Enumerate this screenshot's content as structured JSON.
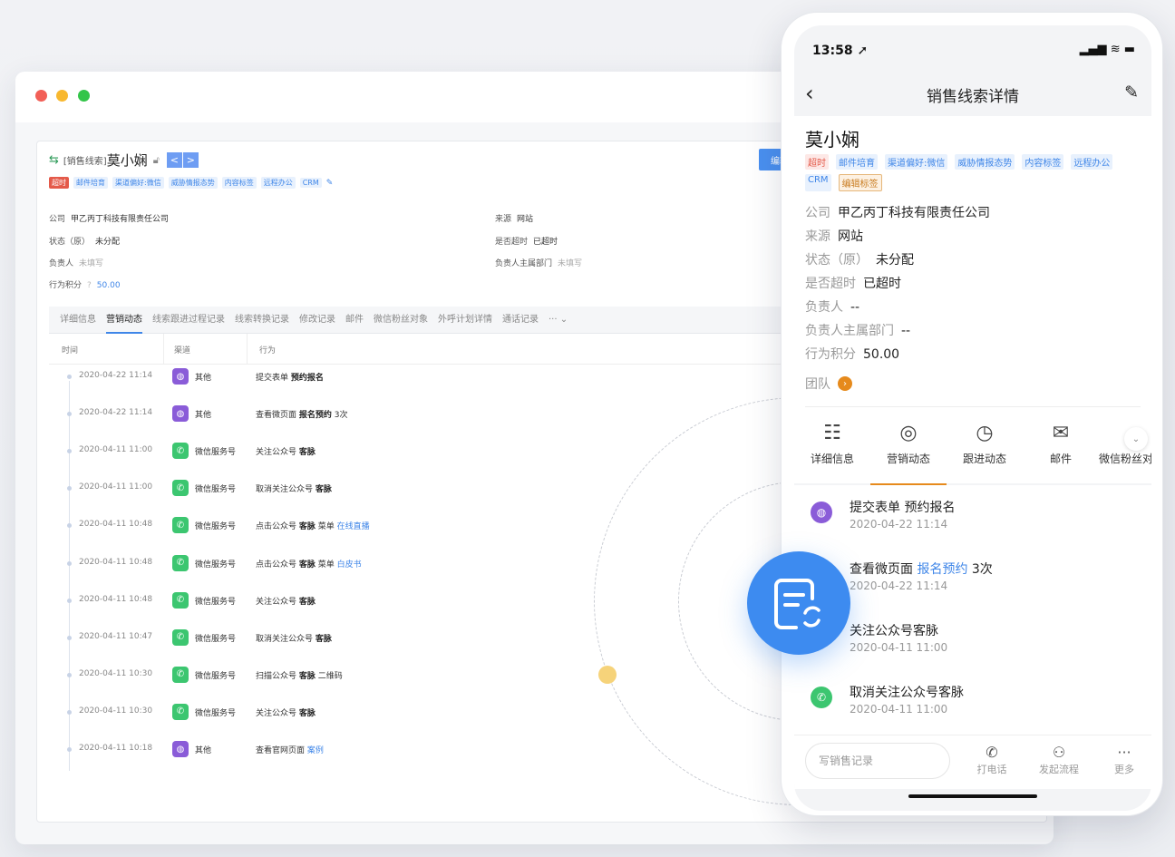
{
  "desktop": {
    "header": {
      "crumb": "[销售线索]",
      "name": "莫小娴",
      "pager_prev": "<",
      "pager_next": ">",
      "edit_label": "编辑"
    },
    "tags": [
      "超时",
      "邮件培育",
      "渠道偏好:微信",
      "威胁情报态势",
      "内容标签",
      "远程办公",
      "CRM"
    ],
    "fields": {
      "company_label": "公司",
      "company_value": "甲乙丙丁科技有限责任公司",
      "status_label": "状态（原）",
      "status_value": "未分配",
      "owner_label": "负责人",
      "owner_value": "未填写",
      "score_label": "行为积分",
      "score_hint": "?",
      "score_value": "50.00",
      "source_label": "来源",
      "source_value": "网站",
      "overdue_label": "是否超时",
      "overdue_value": "已超时",
      "dept_label": "负责人主属部门",
      "dept_value": "未填写"
    },
    "tabs": [
      "详细信息",
      "营销动态",
      "线索跟进过程记录",
      "线索转换记录",
      "修改记录",
      "邮件",
      "微信粉丝对象",
      "外呼计划详情",
      "通话记录",
      "··· ⌄"
    ],
    "table_headers": [
      "时间",
      "渠道",
      "行为"
    ],
    "rows": [
      {
        "time": "2020-04-22 11:14",
        "channel": "其他",
        "action": "提交表单",
        "bold": "预约报名",
        "after": "",
        "link": ""
      },
      {
        "time": "2020-04-22 11:14",
        "channel": "其他",
        "action": "查看微页面",
        "bold": "报名预约",
        "after": " 3次",
        "link": ""
      },
      {
        "time": "2020-04-11 11:00",
        "channel": "微信服务号",
        "action": "关注公众号",
        "bold": "客脉",
        "after": "",
        "link": ""
      },
      {
        "time": "2020-04-11 11:00",
        "channel": "微信服务号",
        "action": "取消关注公众号",
        "bold": "客脉",
        "after": "",
        "link": ""
      },
      {
        "time": "2020-04-11 10:48",
        "channel": "微信服务号",
        "action": "点击公众号",
        "bold": "客脉",
        "after": " 菜单 ",
        "link": "在线直播"
      },
      {
        "time": "2020-04-11 10:48",
        "channel": "微信服务号",
        "action": "点击公众号",
        "bold": "客脉",
        "after": " 菜单 ",
        "link": "白皮书"
      },
      {
        "time": "2020-04-11 10:48",
        "channel": "微信服务号",
        "action": "关注公众号",
        "bold": "客脉",
        "after": "",
        "link": ""
      },
      {
        "time": "2020-04-11 10:47",
        "channel": "微信服务号",
        "action": "取消关注公众号",
        "bold": "客脉",
        "after": "",
        "link": ""
      },
      {
        "time": "2020-04-11 10:30",
        "channel": "微信服务号",
        "action": "扫描公众号",
        "bold": "客脉",
        "after": " 二维码",
        "link": ""
      },
      {
        "time": "2020-04-11 10:30",
        "channel": "微信服务号",
        "action": "关注公众号",
        "bold": "客脉",
        "after": "",
        "link": ""
      },
      {
        "time": "2020-04-11 10:18",
        "channel": "其他",
        "action": "查看官网页面",
        "bold": "",
        "after": " ",
        "link": "案例"
      }
    ]
  },
  "phone": {
    "status_time": "13:58 ➚",
    "status_icons": "▂▄▆ ≋ ▬",
    "nav_title": "销售线索详情",
    "name": "莫小娴",
    "tags": [
      "超时",
      "邮件培育",
      "渠道偏好:微信",
      "威胁情报态势",
      "内容标签",
      "远程办公",
      "CRM",
      "编辑标签"
    ],
    "fields": [
      {
        "label": "公司",
        "value": "甲乙丙丁科技有限责任公司"
      },
      {
        "label": "来源",
        "value": "网站"
      },
      {
        "label": "状态（原）",
        "value": "未分配"
      },
      {
        "label": "是否超时",
        "value": "已超时"
      },
      {
        "label": "负责人",
        "value": "--"
      },
      {
        "label": "负责人主属部门",
        "value": "--"
      },
      {
        "label": "行为积分",
        "value": "50.00"
      }
    ],
    "team_label": "团队",
    "tabs": [
      "详细信息",
      "营销动态",
      "跟进动态",
      "邮件",
      "微信粉丝对象"
    ],
    "feed": [
      {
        "title": "提交表单 预约报名",
        "time": "2020-04-22 11:14"
      },
      {
        "title_pre": "查看微页面 ",
        "title_link": "报名预约",
        "title_post": " 3次",
        "time": "2020-04-22 11:14"
      },
      {
        "title": "关注公众号客脉",
        "time": "2020-04-11 11:00"
      },
      {
        "title": "取消关注公众号客脉",
        "time": "2020-04-11 11:00"
      }
    ],
    "input_placeholder": "写销售记录",
    "actions": [
      "打电话",
      "发起流程",
      "更多"
    ]
  },
  "colors": {
    "accent": "#3d8bf0",
    "orange": "#e68a1c",
    "green": "#3cc670",
    "purple": "#8a5cd8"
  }
}
